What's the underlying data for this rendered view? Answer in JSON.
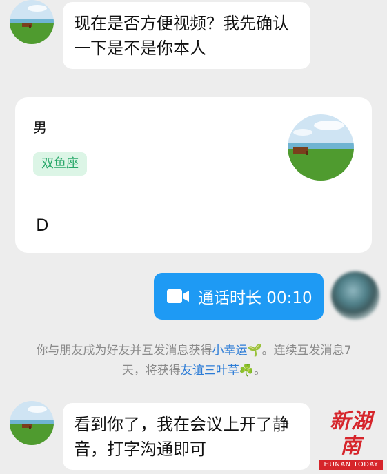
{
  "messages": {
    "top_incoming": "现在是否方便视频？我先确认一下是不是你本人",
    "bottom_incoming": "看到你了，我在会议上开了静音，打字沟通即可"
  },
  "profile_card": {
    "gender": "男",
    "tag": "双鱼座",
    "footer_text": "D"
  },
  "call": {
    "label": "通话时长 00:10",
    "icon": "video-camera-icon"
  },
  "system_notice": {
    "part1": "你与朋友成为好友并互发消息获得",
    "link1": "小幸运",
    "emoji1": "🌱",
    "part2": "。连续互发消息7天，将获得",
    "link2": "友谊三叶草",
    "emoji2": "☘️",
    "part3": "。"
  },
  "watermark": {
    "cn": "新湖南",
    "en": "HUNAN TODAY"
  },
  "colors": {
    "background": "#ededed",
    "bubble_out": "#1e9af4",
    "tag_bg": "#dcf5e6",
    "tag_text": "#29a86a",
    "link": "#2b7bd6",
    "watermark_red": "#d6252b"
  }
}
